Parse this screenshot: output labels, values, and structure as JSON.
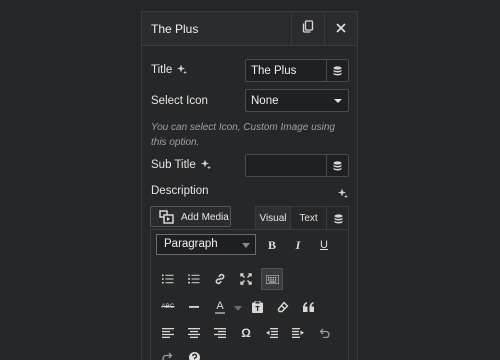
{
  "panel": {
    "title": "The Plus"
  },
  "fields": {
    "title_label": "Title",
    "title_value": "The Plus",
    "select_icon_label": "Select Icon",
    "select_icon_value": "None",
    "help_text": "You can select Icon, Custom Image using this option.",
    "sub_title_label": "Sub Title",
    "sub_title_value": "",
    "description_label": "Description"
  },
  "editor": {
    "add_media_label": "Add Media",
    "tabs": [
      "Visual",
      "Text"
    ],
    "format_value": "Paragraph",
    "text_color_letter": "A",
    "bold": "B",
    "italic": "I",
    "underline": "U",
    "strike": "ABC",
    "omega": "Ω",
    "quote": "“”"
  },
  "icons": {
    "copy": "copy-icon",
    "close": "close-icon",
    "sparkle": "ai-sparkle-icon",
    "dynamic": "database-icon"
  },
  "colors": {
    "background": "#252629",
    "panel": "#262729",
    "border": "#3a3b3e",
    "text": "#e6e6e6",
    "muted": "#a0a0a5"
  }
}
